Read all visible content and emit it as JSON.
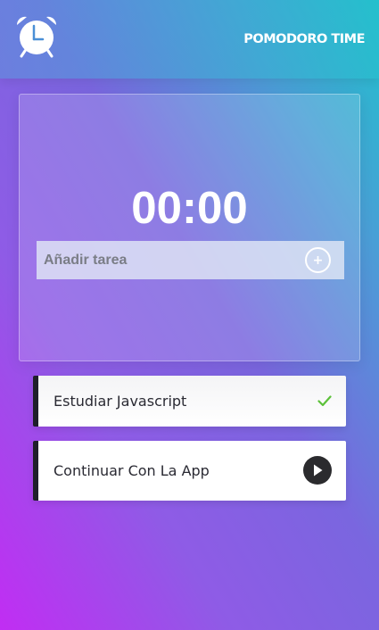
{
  "header": {
    "logo_icon": "alarm-clock-icon",
    "title": "POMODORO TIME"
  },
  "timer": {
    "display": "00:00"
  },
  "task_form": {
    "placeholder": "Añadir tarea",
    "value": "",
    "add_icon": "plus-circle-icon"
  },
  "tasks": [
    {
      "label": "Estudiar Javascript",
      "status": "completed",
      "icon": "check-icon",
      "accent": "#5cc13a"
    },
    {
      "label": "Continuar Con La App",
      "status": "pending",
      "icon": "play-icon",
      "accent": "#2b2b2e"
    }
  ],
  "colors": {
    "gradient_start": "#c12df3",
    "gradient_end": "#20c2cc",
    "task_border": "#1f1f2a"
  }
}
